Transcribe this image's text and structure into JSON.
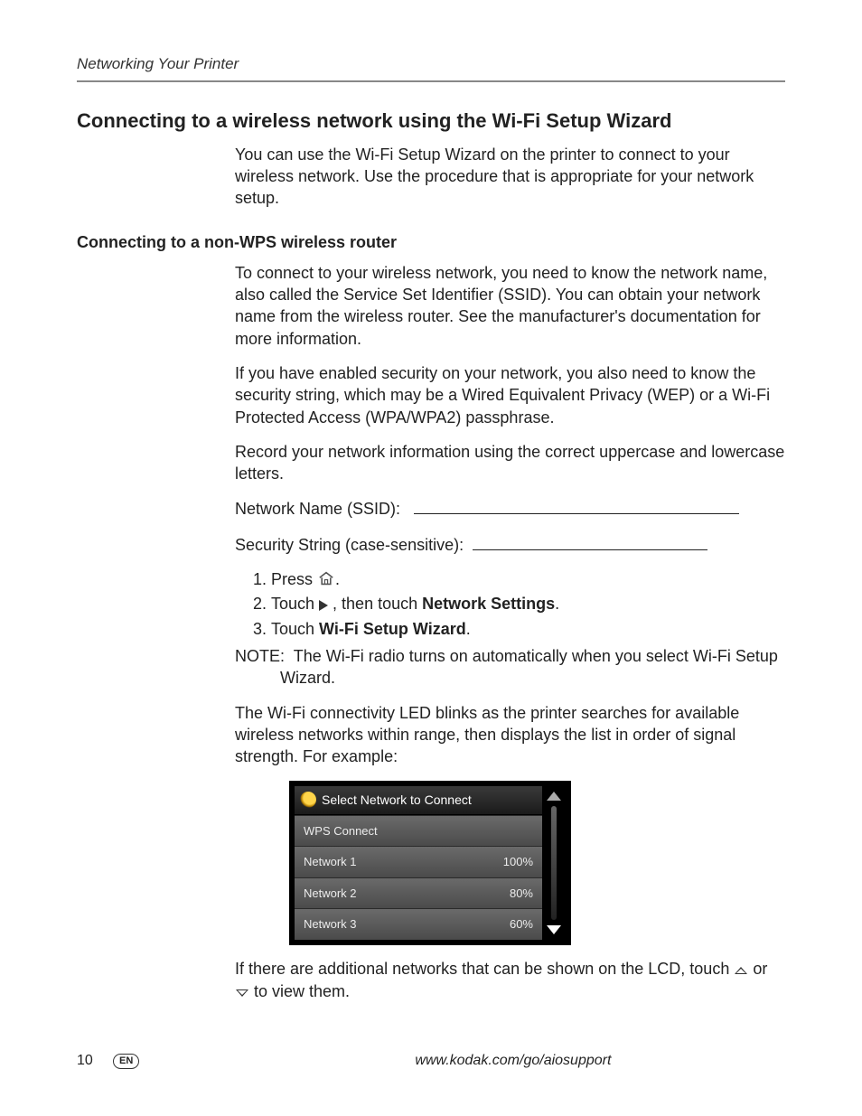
{
  "runningHeader": "Networking Your Printer",
  "title": "Connecting to a wireless network using the Wi-Fi Setup Wizard",
  "intro": "You can use the Wi-Fi Setup Wizard on the printer to connect to your wireless network. Use the procedure that is appropriate for your network setup.",
  "subTitle": "Connecting to a non-WPS wireless router",
  "paragraphs": {
    "p1": "To connect to your wireless network, you need to know the network name, also called the Service Set Identifier (SSID). You can obtain your network name from the wireless router. See the manufacturer's documentation for more information.",
    "p2": "If you have enabled security on your network, you also need to know the security string, which may be a Wired Equivalent Privacy (WEP) or a Wi-Fi Protected Access (WPA/WPA2) passphrase.",
    "p3": "Record your network information using the correct uppercase and lowercase letters."
  },
  "fields": {
    "ssidLabel": "Network Name (SSID):",
    "securityLabel": "Security String (case-sensitive):"
  },
  "steps": {
    "s1_a": "Press ",
    "s1_b": ".",
    "s2_a": "Touch ",
    "s2_b": " , then touch ",
    "s2_bold": "Network Settings",
    "s2_c": ".",
    "s3_a": "Touch ",
    "s3_bold": "Wi-Fi Setup Wizard",
    "s3_b": "."
  },
  "noteLabel": "NOTE:",
  "noteText": "The Wi-Fi radio turns on automatically when you select Wi-Fi Setup Wizard.",
  "p4": "The Wi-Fi connectivity LED blinks as the printer searches for available wireless networks within range, then displays the list in order of signal strength. For example:",
  "lcd": {
    "header": "Select Network to Connect",
    "rows": [
      {
        "name": "WPS Connect",
        "signal": ""
      },
      {
        "name": "Network 1",
        "signal": "100%"
      },
      {
        "name": "Network 2",
        "signal": "80%"
      },
      {
        "name": "Network 3",
        "signal": "60%"
      }
    ]
  },
  "p5_a": "If there are additional networks that can be shown on the LCD, touch ",
  "p5_b": " or ",
  "p5_c": " to view them.",
  "footer": {
    "pageNumber": "10",
    "lang": "EN",
    "url": "www.kodak.com/go/aiosupport"
  }
}
